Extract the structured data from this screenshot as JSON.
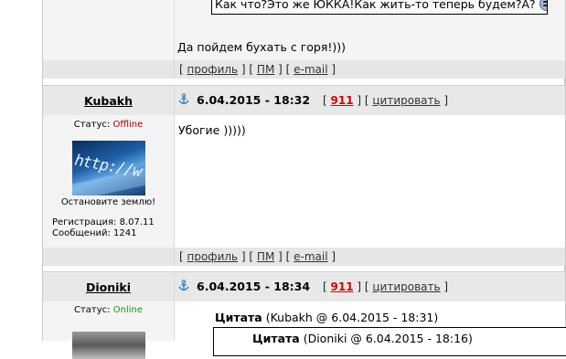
{
  "post0": {
    "quote_text": "Как что?Это же ЮККА!Как жить-то теперь будем?А?",
    "message": "Да пойдем бухать с горя!)))"
  },
  "footer_links": {
    "profile": "профиль",
    "pm": "ПМ",
    "email": "e-mail"
  },
  "post1": {
    "username": "Kubakh",
    "status_label": "Статус:",
    "status_value": "Offline",
    "avatar_caption": "Остановите землю!",
    "registration": "Регистрация: 8.07.11",
    "posts_count": "Сообщений: 1241",
    "date": "6.04.2015 - 18:32",
    "post_id": "911",
    "quote_label": "цитировать",
    "message": "Убогие )))))"
  },
  "post2": {
    "username": "Dioniki",
    "status_label": "Статус:",
    "status_value": "Online",
    "date": "6.04.2015 - 18:34",
    "post_id": "911",
    "quote_label": "цитировать",
    "quote_title": "Цитата",
    "quote_meta": "(Kubakh @ 6.04.2015 - 18:31)",
    "inner_quote_title": "Цитата",
    "inner_quote_meta": "(Dioniki @ 6.04.2015 - 18:16)"
  },
  "colors": {
    "offline": "#a00000",
    "online": "#1a9a1a",
    "post_id": "#d40000",
    "header_bg": "#e8e8e8",
    "side_bg": "#f4f4f4"
  },
  "icons": [
    "anchor-icon",
    "smiley-icon"
  ]
}
